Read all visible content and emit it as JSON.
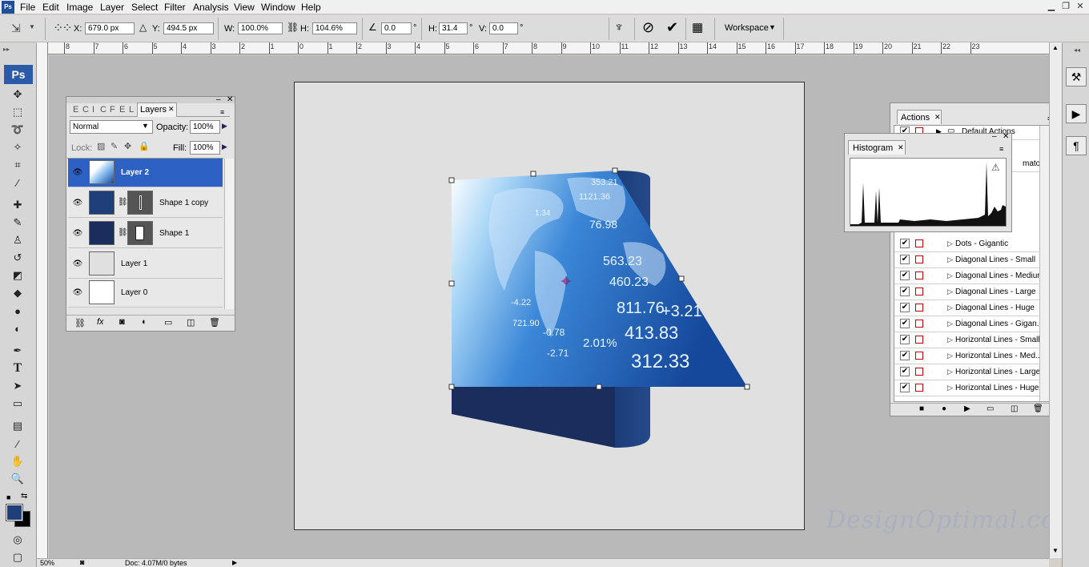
{
  "menu": {
    "items": [
      "File",
      "Edit",
      "Image",
      "Layer",
      "Select",
      "Filter",
      "Analysis",
      "View",
      "Window",
      "Help"
    ]
  },
  "options_bar": {
    "x_label": "X:",
    "x_value": "679.0 px",
    "y_label": "Y:",
    "y_value": "494.5 px",
    "w_label": "W:",
    "w_value": "100.0%",
    "h_label": "H:",
    "h_value": "104.6%",
    "angle_value": "0.0",
    "degree": "°",
    "hskew_label": "H:",
    "hskew_value": "31.4",
    "vskew_label": "V:",
    "vskew_value": "0.0",
    "workspace_label": "Workspace"
  },
  "ruler": {
    "ticks": [
      "8",
      "7",
      "6",
      "5",
      "4",
      "3",
      "2",
      "1",
      "0",
      "1",
      "2",
      "3",
      "4",
      "5",
      "6",
      "7",
      "8",
      "9",
      "10",
      "11",
      "12",
      "13",
      "14",
      "15",
      "16",
      "17",
      "18",
      "19",
      "20",
      "21",
      "22",
      "23"
    ]
  },
  "toolbox": {
    "logo": "Ps",
    "fg_color": "#1f3f7a",
    "bg_color": "#000000"
  },
  "layers_panel": {
    "collapsed_tabs": [
      "E",
      "C",
      "I",
      "C",
      "F",
      "E",
      "L"
    ],
    "tab_label": "Layers",
    "blend_mode": "Normal",
    "opacity_label": "Opacity:",
    "opacity_value": "100%",
    "lock_label": "Lock:",
    "fill_label": "Fill:",
    "fill_value": "100%",
    "layers": [
      {
        "name": "Layer 2",
        "selected": true
      },
      {
        "name": "Shape 1 copy",
        "selected": false
      },
      {
        "name": "Shape 1",
        "selected": false
      },
      {
        "name": "Layer 1",
        "selected": false
      },
      {
        "name": "Layer 0",
        "selected": false
      }
    ]
  },
  "actions_panel": {
    "tab_label": "Actions",
    "set_name": "Default Actions",
    "partial_item": "mator",
    "items": [
      "Dots - Gigantic",
      "Diagonal Lines - Small",
      "Diagonal Lines - Medium",
      "Diagonal Lines - Large",
      "Diagonal Lines - Huge",
      "Diagonal Lines - Gigan...",
      "Horizontal Lines - Small",
      "Horizontal Lines - Med...",
      "Horizontal Lines - Large",
      "Horizontal Lines - Huge"
    ]
  },
  "histogram_panel": {
    "tab_label": "Histogram"
  },
  "canvas": {
    "numbers": [
      "353.21",
      "1121.36",
      "1.34",
      "76.98",
      "563.23",
      "460.23",
      "811.76",
      "+3.21",
      "413.83",
      "312.33",
      "2.01%",
      "-0.78",
      "721.90",
      "-2.71",
      "-4.22"
    ]
  },
  "status": {
    "zoom": "50%",
    "doc": "Doc: 4.07M/0 bytes"
  },
  "watermark": "DesignOptimal.com"
}
